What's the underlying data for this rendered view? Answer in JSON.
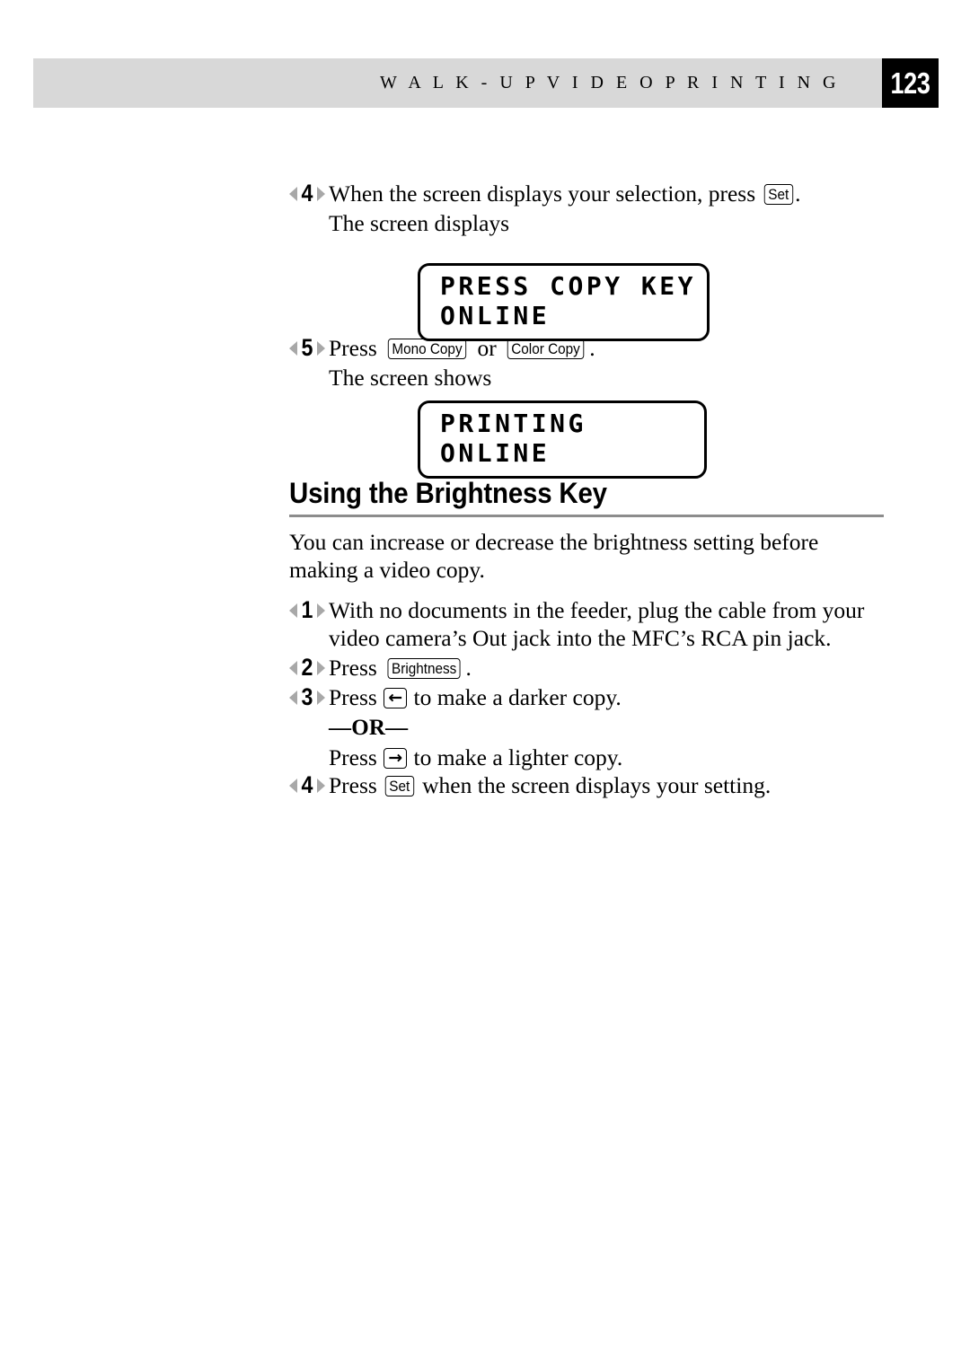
{
  "header": {
    "running_title": "W A L K - U P   V I D E O   P R I N T I N G",
    "page_number": "123"
  },
  "steps_top": [
    {
      "number": "4",
      "text_before_key": "When the screen displays your selection, press ",
      "key": "Set",
      "text_after_key": ".",
      "continuation": "The screen displays"
    },
    {
      "number": "5",
      "text_before_key": "Press ",
      "key": "Mono Copy",
      "text_middle": " or ",
      "key2": "Color Copy",
      "text_after_key": ".",
      "continuation": "The screen shows"
    }
  ],
  "lcd_displays": [
    {
      "line1": "PRESS COPY KEY",
      "line2": "ONLINE"
    },
    {
      "line1": "PRINTING",
      "line2": "ONLINE"
    }
  ],
  "section": {
    "heading": "Using the Brightness Key",
    "intro": "You can increase or decrease the brightness setting before making a video copy.",
    "steps": [
      {
        "number": "1",
        "line1": "With no documents in the feeder, plug the cable from your video",
        "line2": "camera’s Out jack into the MFC’s RCA pin jack."
      },
      {
        "number": "2",
        "text_before_key": "Press ",
        "key": "Brightness",
        "text_after_key": "."
      },
      {
        "number": "3",
        "text_before_key": "Press ",
        "key": "←",
        "text_after_key": " to make a darker copy."
      }
    ],
    "or_label": "—OR—",
    "or_alternative": {
      "text_before_key": "Press ",
      "key": "→",
      "text_after_key": " to make a lighter copy."
    },
    "final_step": {
      "number": "4",
      "text_before_key": "Press ",
      "key": "Set",
      "text_after_key": " when the screen displays your setting."
    }
  },
  "colors": {
    "header_band": "#d8d8d8",
    "page_box": "#000000",
    "marker_wing": "#a8a8a8",
    "section_rule": "#8c8c8c"
  }
}
